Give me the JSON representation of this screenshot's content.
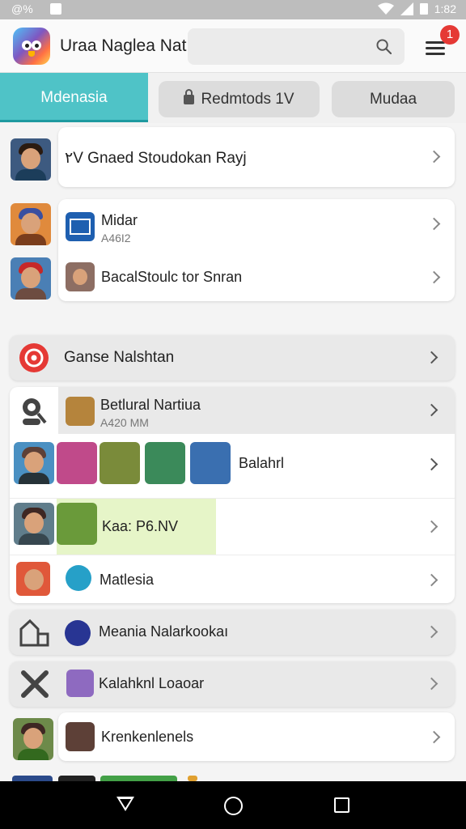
{
  "status_bar": {
    "left_text": "@%",
    "time": "1:82"
  },
  "app_bar": {
    "title": "Uraa Naglea Nat",
    "notification_count": "1"
  },
  "tabs": [
    {
      "label": "Mdenasia",
      "active": true
    },
    {
      "label": "Redmtods 1V",
      "active": false,
      "icon": "lock-icon"
    },
    {
      "label": "Mudaa",
      "active": false
    }
  ],
  "items": [
    {
      "title": "٢V Gnaed Stoudokan Rayj"
    },
    {
      "title": "Midar",
      "subtitle": "A46I2"
    },
    {
      "title": "BacalStoulc tor Snran"
    },
    {
      "title": "Ganse Nalshtan",
      "icon": "record-icon"
    },
    {
      "title": "Betlural Nartiua",
      "subtitle": "A420 MM",
      "icon": "search-person-icon"
    },
    {
      "title": "Balahrl"
    },
    {
      "title": "Kaa: P6.NV"
    },
    {
      "title": "Matlesia"
    },
    {
      "title": "Meania Nalarkookaı",
      "icon": "building-icon"
    },
    {
      "title": "Kalahknl Loaoar",
      "icon": "tools-icon"
    },
    {
      "title": "Krenkenlenels"
    }
  ],
  "colors": {
    "accent": "#4fc3c7",
    "badge": "#e53935",
    "highlight": "#e6f5c8"
  }
}
